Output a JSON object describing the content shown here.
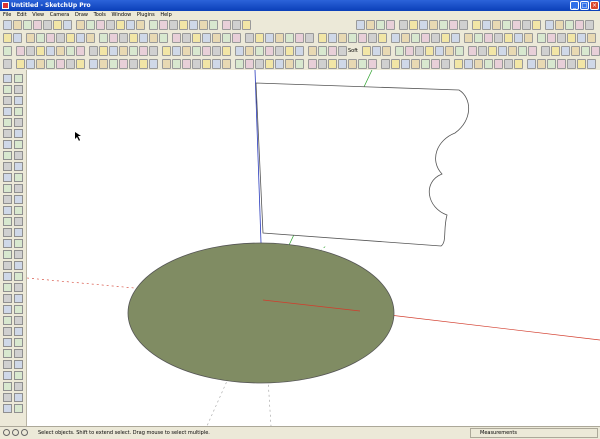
{
  "window": {
    "title": "Untitled - SketchUp Pro",
    "minimize": "_",
    "maximize": "□",
    "close": "×"
  },
  "menu": {
    "items": [
      "File",
      "Edit",
      "View",
      "Camera",
      "Draw",
      "Tools",
      "Window",
      "Plugins",
      "Help"
    ]
  },
  "toolbar": {
    "shadow_label": "J F M A M J J A S O N D 07:20 AM Noon 04:46 PM",
    "colors": {
      "window_title_bg": "#1f56cf",
      "model_face": "#808c63",
      "axis_red": "#d23b2b",
      "axis_green": "#2ba22b",
      "axis_blue": "#2a3bbd"
    },
    "icon_names": [
      "new",
      "open",
      "save",
      "cut",
      "copy",
      "paste",
      "erase",
      "undo",
      "redo",
      "print",
      "model-info",
      "select",
      "make-component",
      "paint-bucket",
      "eraser",
      "rectangle",
      "line",
      "circle",
      "arc",
      "polygon",
      "freehand",
      "move",
      "push-pull",
      "rotate",
      "follow-me",
      "scale",
      "offset",
      "tape-measure",
      "dimension",
      "protractor",
      "text",
      "axes",
      "3d-text",
      "orbit",
      "pan",
      "zoom",
      "zoom-window",
      "zoom-extents",
      "previous",
      "next",
      "walk",
      "position-camera",
      "look-around",
      "section-plane",
      "x-ray",
      "wireframe",
      "hidden-line",
      "shaded",
      "shaded-with-textures",
      "monochrome",
      "iso",
      "top",
      "front",
      "right",
      "back",
      "left",
      "bottom"
    ],
    "row3_text": "Soft"
  },
  "scene": {
    "status_text": "Select objects. Shift to extend select. Drag mouse to select multiple.",
    "measurements_label": "Measurements"
  }
}
